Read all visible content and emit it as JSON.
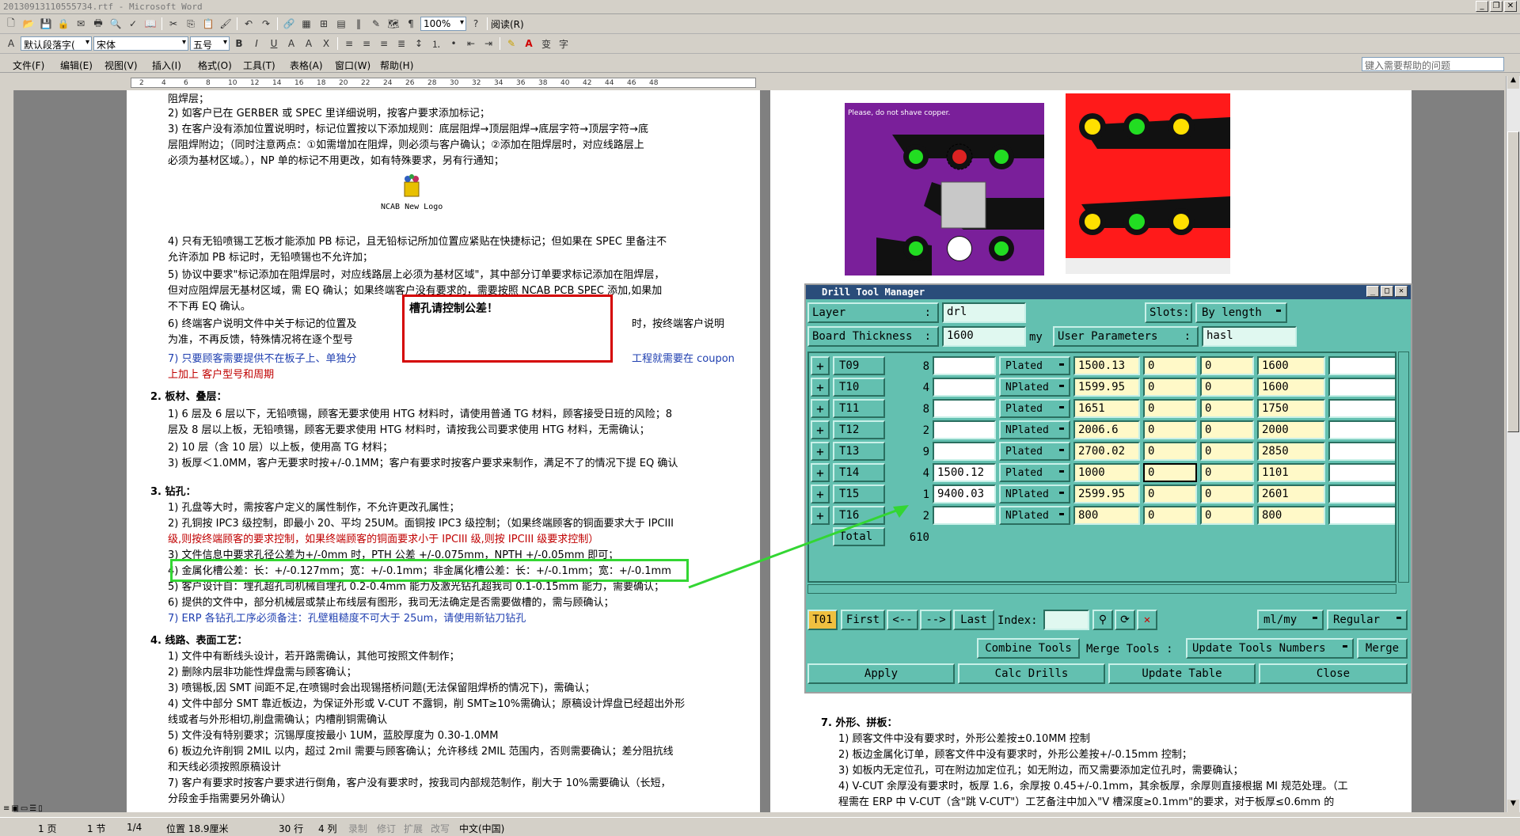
{
  "window": {
    "title": "20130913110555734.rtf - Microsoft Word"
  },
  "toolbar": {
    "zoom": "100%",
    "read_label": "阅读(R)",
    "style": "默认段落字(",
    "font": "宋体",
    "size": "五号"
  },
  "menu": {
    "items": [
      "文件(F)",
      "编辑(E)",
      "视图(V)",
      "插入(I)",
      "格式(O)",
      "工具(T)",
      "表格(A)",
      "窗口(W)",
      "帮助(H)"
    ],
    "help_placeholder": "键入需要帮助的问题"
  },
  "ruler": {
    "ticks": [
      "2",
      "4",
      "6",
      "8",
      "10",
      "12",
      "14",
      "16",
      "18",
      "20",
      "22",
      "24",
      "26",
      "28",
      "30",
      "32",
      "34",
      "36",
      "38",
      "40",
      "42",
      "44",
      "46",
      "48"
    ]
  },
  "page1": {
    "lines": [
      {
        "t": "阻焊层；",
        "c": ""
      },
      {
        "t": "2)  如客户已在 GERBER 或 SPEC 里详细说明，按客户要求添加标记；",
        "c": ""
      },
      {
        "t": "3)  在客户没有添加位置说明时，标记位置按以下添加规则：底层阻焊→顶层阻焊→底层字符→顶层字符→底",
        "c": ""
      },
      {
        "t": "     层阻焊附边；（同时注意两点：①如需增加在阻焊，则必须与客户确认；②添加在阻焊层时，对应线路层上",
        "c": ""
      },
      {
        "t": "     必须为基材区域。），NP 单的标记不用更改，如有特殊要求，另有行通知；",
        "c": ""
      },
      {
        "t": "4)  只有无铅喷锡工艺板才能添加 PB 标记，且无铅标记所加位置应紧贴在快捷标记；但如果在 SPEC 里备注不",
        "c": ""
      },
      {
        "t": "     允许添加 PB 标记时，无铅喷锡也不允许加；",
        "c": ""
      },
      {
        "t": "5)  协议中要求\"标记添加在阻焊层时，对应线路层上必须为基材区域\"，其中部分订单要求标记添加在阻焊层，",
        "c": ""
      },
      {
        "t": "     但对应阻焊层无基材区域，需 EQ 确认；如果终端客户没有要求的，需要按照 NCAB PCB SPEC 添加,如果加",
        "c": ""
      },
      {
        "t": "     不下再 EQ 确认。",
        "c": ""
      },
      {
        "t": "6)  终端客户说明文件中关于标记的位置及",
        "c": ""
      },
      {
        "t": "     为准，不再反馈，特殊情况将在逐个型号",
        "c": ""
      },
      {
        "t": "7)  只要顾客需要提供不在板子上、单独分",
        "c": "blue"
      },
      {
        "t": "     上加上  客户型号和周期",
        "c": "red"
      },
      {
        "t": "2.   板材、叠层：",
        "c": "bold"
      },
      {
        "t": "1)  6 层及 6 层以下，无铅喷锡，顾客无要求使用 HTG 材料时，请使用普通 TG 材料，顾客接受日班的风险；8",
        "c": ""
      },
      {
        "t": "     层及 8 层以上板，无铅喷锡，顾客无要求使用 HTG 材料时，请按我公司要求使用 HTG 材料，无需确认；",
        "c": ""
      },
      {
        "t": "2)  10 层（含 10 层）以上板，使用高 TG 材料；",
        "c": ""
      },
      {
        "t": "3)  板厚＜1.0MM，客户无要求时按+/-0.1MM；客户有要求时按客户要求来制作，满足不了的情况下提 EQ 确认",
        "c": ""
      },
      {
        "t": "3.   钻孔：",
        "c": "bold"
      },
      {
        "t": "1)  孔盘等大时，需按客户定义的属性制作，不允许更改孔属性；",
        "c": ""
      },
      {
        "t": "2)  孔铜按 IPC3 级控制，即最小 20、平均 25UM。面铜按 IPC3 级控制；（如果终端顾客的铜面要求大于 IPCIII",
        "c": ""
      },
      {
        "t": "     级,则按终端顾客的要求控制，如果终端顾客的铜面要求小于 IPCIII 级,则按 IPCIII 级要求控制）",
        "c": "red"
      },
      {
        "t": "3)  文件信息中要求孔径公差为+/-0mm 时，PTH 公差 +/-0.075mm，NPTH +/-0.05mm 即可；",
        "c": ""
      },
      {
        "t": "4)  金属化槽公差：长：+/-0.127mm；宽：+/-0.1mm；非金属化槽公差：长：+/-0.1mm；宽：+/-0.1mm",
        "c": ""
      },
      {
        "t": "5)  客户设计自：埋孔超孔司机械自埋孔 0.2-0.4mm 能力及激光钻孔超我司 0.1-0.15mm 能力，需要确认；",
        "c": ""
      },
      {
        "t": "6)  提供的文件中，部分机械层或禁止布线层有图形，我司无法确定是否需要做槽的，需与顾确认；",
        "c": ""
      },
      {
        "t": "7)  ERP 各钻孔工序必须备注：孔壁粗糙度不可大于 25um，请使用新钻刀钻孔",
        "c": "blue"
      },
      {
        "t": "4.   线路、表面工艺：",
        "c": "bold"
      },
      {
        "t": "1)  文件中有断线头设计，若开路需确认，其他可按照文件制作；",
        "c": ""
      },
      {
        "t": "2)  删除内层非功能性焊盘需与顾客确认；",
        "c": ""
      },
      {
        "t": "3)  喷锡板,因 SMT 间距不足,在喷锡时会出现锡搭桥问题(无法保留阻焊桥的情况下)，需确认；",
        "c": ""
      },
      {
        "t": "4)  文件中部分 SMT 靠近板边，为保证外形或 V-CUT 不露铜，削 SMT≥10%需确认；原稿设计焊盘已经超出外形",
        "c": ""
      },
      {
        "t": "     线或者与外形相切,削盘需确认；内槽削铜需确认",
        "c": ""
      },
      {
        "t": "5)  文件没有特别要求；沉锡厚度按最小 1UM，蓝胶厚度为 0.30-1.0MM",
        "c": ""
      },
      {
        "t": "6)  板边允许削铜 2MIL 以内，超过 2mil 需要与顾客确认；允许移线 2MIL 范围内，否则需要确认；差分阻抗线",
        "c": ""
      },
      {
        "t": "     和天线必须按照原稿设计",
        "c": ""
      },
      {
        "t": "7)  客户有要求时按客户要求进行倒角，客户没有要求时，按我司内部规范制作，削大于 10%需要确认（长短，",
        "c": ""
      },
      {
        "t": "     分段金手指需要另外确认）",
        "c": ""
      }
    ],
    "logo_caption": "NCAB New Logo",
    "callout": "槽孔请控制公差！",
    "trail1": "时，按终端客户说明",
    "trail2": "工程就需要在 coupon"
  },
  "page2": {
    "pcb_note": "Please, do not shave copper.",
    "lines": [
      {
        "t": "7.   外形、拼板：",
        "c": "bold"
      },
      {
        "t": "1)  顾客文件中没有要求时，外形公差按±0.10MM 控制",
        "c": ""
      },
      {
        "t": "2)  板边金属化订单，顾客文件中没有要求时，外形公差按+/-0.15mm 控制；",
        "c": ""
      },
      {
        "t": "3)  如板内无定位孔，可在附边加定位孔；如无附边，而又需要添加定位孔时，需要确认；",
        "c": ""
      },
      {
        "t": "4)  V-CUT 余厚没有要求时，板厚 1.6，余厚按 0.45+/-0.1mm，其余板厚，余厚则直接根据 MI 规范处理。（工",
        "c": ""
      },
      {
        "t": "     程需在 ERP 中 V-CUT（含\"跳 V-CUT\"）工艺备注中加入\"V 槽深度≥0.1mm\"的要求，对于板厚≤0.6mm 的",
        "c": ""
      }
    ]
  },
  "drill_tool_manager": {
    "title": "Drill Tool Manager",
    "layer_label": "Layer",
    "layer_value": "drl",
    "slots_label": "Slots:",
    "slots_value": "By length",
    "thickness_label": "Board Thickness",
    "thickness_value": "1600",
    "thickness_unit": "my",
    "user_params_label": "User Parameters",
    "user_params_value": "hasl",
    "rows": [
      {
        "tool": "T09",
        "count": "8",
        "size": "",
        "type": "Plated",
        "finish": "1500.13",
        "a": "0",
        "b": "0",
        "c": "1600"
      },
      {
        "tool": "T10",
        "count": "4",
        "size": "",
        "type": "NPlated",
        "finish": "1599.95",
        "a": "0",
        "b": "0",
        "c": "1600"
      },
      {
        "tool": "T11",
        "count": "8",
        "size": "",
        "type": "Plated",
        "finish": "1651",
        "a": "0",
        "b": "0",
        "c": "1750"
      },
      {
        "tool": "T12",
        "count": "2",
        "size": "",
        "type": "NPlated",
        "finish": "2006.6",
        "a": "0",
        "b": "0",
        "c": "2000"
      },
      {
        "tool": "T13",
        "count": "9",
        "size": "",
        "type": "Plated",
        "finish": "2700.02",
        "a": "0",
        "b": "0",
        "c": "2850"
      },
      {
        "tool": "T14",
        "count": "4",
        "size": "1500.12",
        "type": "Plated",
        "finish": "1000",
        "a": "0",
        "b": "0",
        "c": "1101"
      },
      {
        "tool": "T15",
        "count": "1",
        "size": "9400.03",
        "type": "NPlated",
        "finish": "2599.95",
        "a": "0",
        "b": "0",
        "c": "2601"
      },
      {
        "tool": "T16",
        "count": "2",
        "size": "",
        "type": "NPlated",
        "finish": "800",
        "a": "0",
        "b": "0",
        "c": "800"
      }
    ],
    "total_label": "Total",
    "total_value": "610",
    "nav": {
      "current": "T01",
      "first": "First",
      "prev": "<--",
      "next": "-->",
      "last": "Last",
      "index": "Index:",
      "units": "ml/my",
      "mode": "Regular"
    },
    "buttons": {
      "combine": "Combine Tools",
      "merge_label": "Merge Tools :",
      "update_numbers": "Update Tools Numbers",
      "merge": "Merge",
      "apply": "Apply",
      "calc": "Calc Drills",
      "update_table": "Update Table",
      "close": "Close"
    }
  },
  "status": {
    "page": "1 页",
    "section": "1 节",
    "count": "1/4",
    "pos": "位置 18.9厘米",
    "row": "30 行",
    "col": "4 列",
    "rec": "录制",
    "rev": "修订",
    "ext": "扩展",
    "ovr": "改写",
    "lang": "中文(中国)"
  }
}
